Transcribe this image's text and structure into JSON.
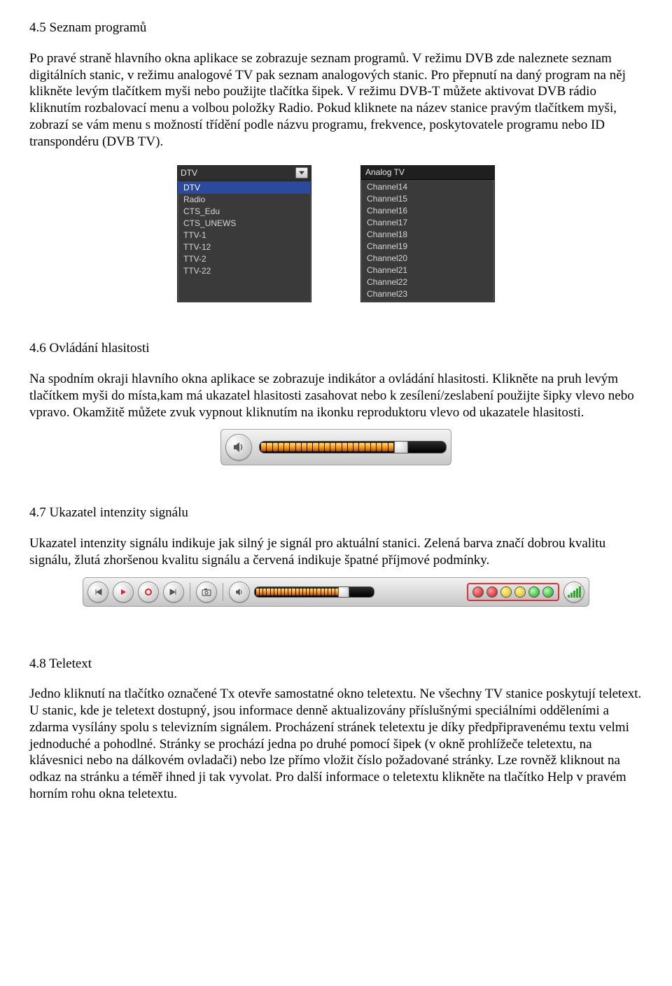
{
  "s45": {
    "heading": "4.5 Seznam programů",
    "para": "Po pravé straně hlavního okna aplikace se zobrazuje seznam programů. V režimu DVB zde naleznete seznam digitálních stanic, v režimu analogové TV pak seznam analogových stanic. Pro přepnutí na daný program na něj klikněte levým tlačítkem myši nebo použijte tlačítka šipek. V režimu DVB-T můžete aktivovat DVB rádio kliknutím rozbalovací menu a volbou položky Radio. Pokud kliknete na název stanice pravým tlačítkem myši, zobrazí se vám menu s možností třídění podle názvu programu, frekvence, poskytovatele programu nebo ID transpondéru (DVB TV)."
  },
  "dtv_panel": {
    "title": "DTV",
    "items": [
      "DTV",
      "Radio",
      "CTS_Edu",
      "CTS_UNEWS",
      "TTV-1",
      "TTV-12",
      "TTV-2",
      "TTV-22"
    ],
    "selected_index": 0
  },
  "analog_panel": {
    "title": "Analog TV",
    "items": [
      "Channel14",
      "Channel15",
      "Channel16",
      "Channel17",
      "Channel18",
      "Channel19",
      "Channel20",
      "Channel21",
      "Channel22",
      "Channel23"
    ]
  },
  "s46": {
    "heading": "4.6 Ovládání hlasitosti",
    "para": "Na spodním okraji hlavního okna aplikace se zobrazuje indikátor a ovládání hlasitosti. Klikněte na pruh levým tlačítkem myši do místa,kam má ukazatel hlasitosti zasahovat nebo k zesílení/zeslabení použijte šipky vlevo nebo vpravo. Okamžitě můžete zvuk vypnout kliknutím na ikonku reproduktoru vlevo od ukazatele hlasitosti."
  },
  "s47": {
    "heading": "4.7 Ukazatel intenzity signálu",
    "para": "Ukazatel intenzity signálu indikuje jak silný je signál pro aktuální stanici. Zelená barva značí dobrou kvalitu signálu, žlutá zhoršenou kvalitu signálu a červená indikuje špatné příjmové podmínky."
  },
  "s48": {
    "heading": "4.8 Teletext",
    "para": "Jedno kliknutí na tlačítko označené Tx otevře samostatné okno teletextu. Ne všechny TV stanice poskytují teletext. U stanic, kde je teletext dostupný, jsou informace denně aktualizovány příslušnými speciálními odděleními a zdarma vysílány spolu s televizním signálem. Procházení stránek teletextu je díky předpřipravenému textu velmi jednoduché a pohodlné. Stránky se prochází jedna po druhé pomocí šipek (v okně prohlížeče teletextu, na klávesnici nebo na dálkovém ovladači) nebo lze přímo vložit číslo požadované stránky. Lze rovněž kliknout na odkaz na stránku a téměř ihned ji tak vyvolat. Pro další informace o teletextu klikněte na tlačítko Help v pravém horním rohu okna teletextu."
  },
  "colors": {
    "signal_red": "#e03030",
    "signal_yellow": "#d7b800",
    "signal_green": "#12a012"
  }
}
